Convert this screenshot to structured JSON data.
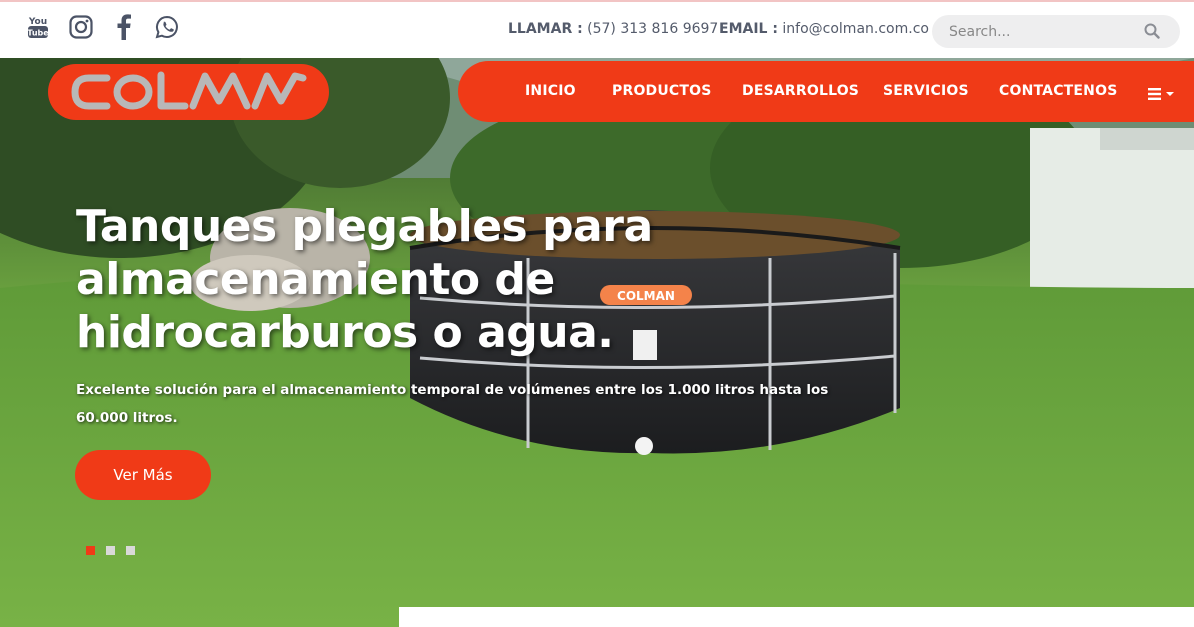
{
  "social": {
    "icons": [
      "youtube-icon",
      "instagram-icon",
      "facebook-icon",
      "whatsapp-icon"
    ],
    "youtube_text": "You\nTube"
  },
  "contact": {
    "phone_label": "LLAMAR :",
    "phone_value": "(57) 313 816 9697",
    "email_label": "EMAIL :",
    "email_value": "info@colman.com.co"
  },
  "search": {
    "placeholder": "Search..."
  },
  "brand": {
    "logo_text": "COLMAN",
    "accent_color": "#f03a17"
  },
  "nav": {
    "items": [
      "INICIO",
      "PRODUCTOS",
      "DESARROLLOS",
      "SERVICIOS",
      "CONTACTENOS"
    ],
    "menu_icon": "list-menu-icon"
  },
  "hero": {
    "title": "Tanques plegables para almacenamiento de hidrocarburos o agua.",
    "subtitle": "Excelente solución para el almacenamiento temporal de volúmenes entre los 1.000 litros hasta los 60.000 litros.",
    "cta_label": "Ver Más",
    "slides_total": 3,
    "active_slide": 1
  }
}
